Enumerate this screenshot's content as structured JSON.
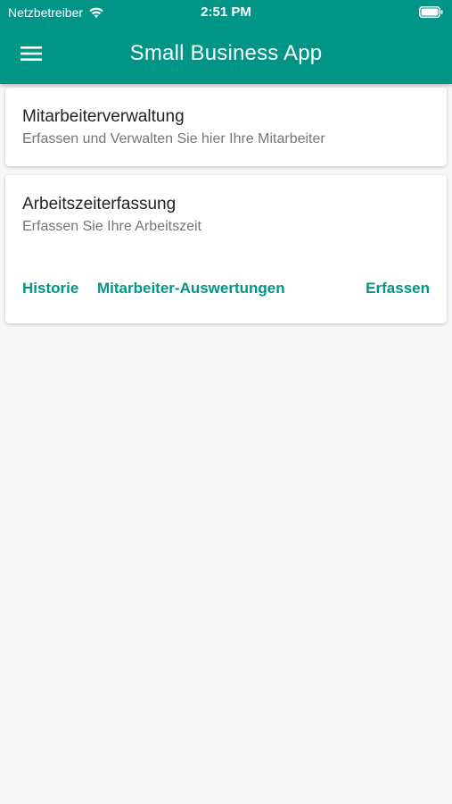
{
  "status_bar": {
    "carrier": "Netzbetreiber",
    "time": "2:51 PM"
  },
  "app_bar": {
    "title": "Small Business App",
    "menu_icon": "hamburger-menu-icon"
  },
  "colors": {
    "primary": "#009587",
    "background": "#f6f6f6",
    "card": "#ffffff"
  },
  "cards": [
    {
      "title": "Mitarbeiterverwaltung",
      "subtitle": "Erfassen und Verwalten Sie hier Ihre Mitarbeiter"
    },
    {
      "title": "Arbeitszeiterfassung",
      "subtitle": "Erfassen Sie Ihre Arbeitszeit",
      "actions": {
        "history": "Historie",
        "evaluations": "Mitarbeiter-Auswertungen",
        "record": "Erfassen"
      }
    }
  ]
}
